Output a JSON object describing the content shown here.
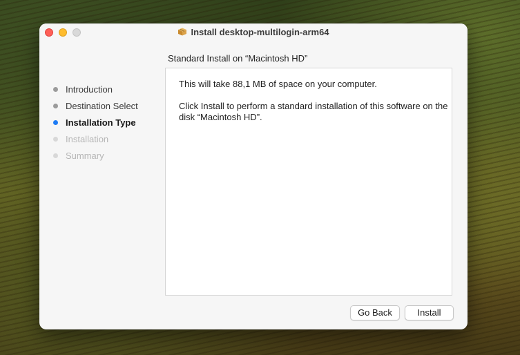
{
  "window": {
    "title": "Install desktop-multilogin-arm64",
    "title_icon": "package-icon"
  },
  "heading": "Standard Install on “Macintosh HD”",
  "sidebar": {
    "steps": [
      {
        "label": "Introduction",
        "state": "done"
      },
      {
        "label": "Destination Select",
        "state": "done"
      },
      {
        "label": "Installation Type",
        "state": "current"
      },
      {
        "label": "Installation",
        "state": "todo"
      },
      {
        "label": "Summary",
        "state": "todo"
      }
    ]
  },
  "content": {
    "line1": "This will take 88,1 MB of space on your computer.",
    "line2": "Click Install to perform a standard installation of this software on the disk “Macintosh HD”."
  },
  "buttons": {
    "go_back": "Go Back",
    "install": "Install"
  },
  "colors": {
    "close": "#fe5f57",
    "minimize": "#febc2e",
    "zoom_disabled": "#d9d9d9",
    "current_step": "#1e7cf5"
  }
}
